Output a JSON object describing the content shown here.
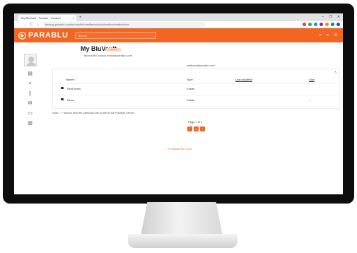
{
  "browser": {
    "tab_title": "My BluVault · Parablu · Parablu",
    "tab_close": "×",
    "new_tab": "+",
    "window_controls": [
      "–",
      "❐",
      "✕"
    ],
    "back": "←",
    "forward": "→",
    "reload": "C",
    "home": "⌂",
    "url": "backup.parablu.com/bluvault/#!/myfiles/outlook/mailbox/mails/inbox",
    "extension_colors": [
      "#e53935",
      "#43a047",
      "#1e88e5",
      "#8e24aa",
      "#fb8c00",
      "#00897b",
      "#3949ab"
    ]
  },
  "header": {
    "brand": "PARABLU",
    "search_placeholder": "Search",
    "icons": [
      "▾",
      "≡",
      "⏻"
    ],
    "brand_color": "#f26522"
  },
  "sidebar": {
    "items": [
      {
        "icon": "file-icon",
        "glyph": "▤"
      },
      {
        "icon": "share-icon",
        "glyph": "<"
      },
      {
        "icon": "document-icon",
        "glyph": "▯"
      },
      {
        "icon": "mail-icon",
        "glyph": "✉"
      },
      {
        "icon": "monitor-icon",
        "glyph": "▭"
      },
      {
        "icon": "trash-icon",
        "glyph": "▥"
      }
    ]
  },
  "main": {
    "title": "My BluVault",
    "badge": "Outlook",
    "subtitle": "Microsoft Outlook mbox@parablu.com",
    "center_text": "mailbox@parablu.com",
    "collapse_glyph": "˄",
    "table": {
      "headers": [
        "Name ↑",
        "Type",
        "Last modified",
        "Size"
      ],
      "rows": [
        {
          "name": "Sent Items",
          "type": "Folder",
          "modified": "",
          "size": ""
        },
        {
          "name": "Inbox",
          "type": "Folder",
          "modified": "",
          "size": "--"
        }
      ]
    },
    "note": "Note :- * means that the particular file is still at the Parablu Server.",
    "page_info": "Page 1 of 1",
    "pager": [
      "‹",
      "1",
      "›"
    ],
    "footer": "© Parablu Inc 2019"
  }
}
